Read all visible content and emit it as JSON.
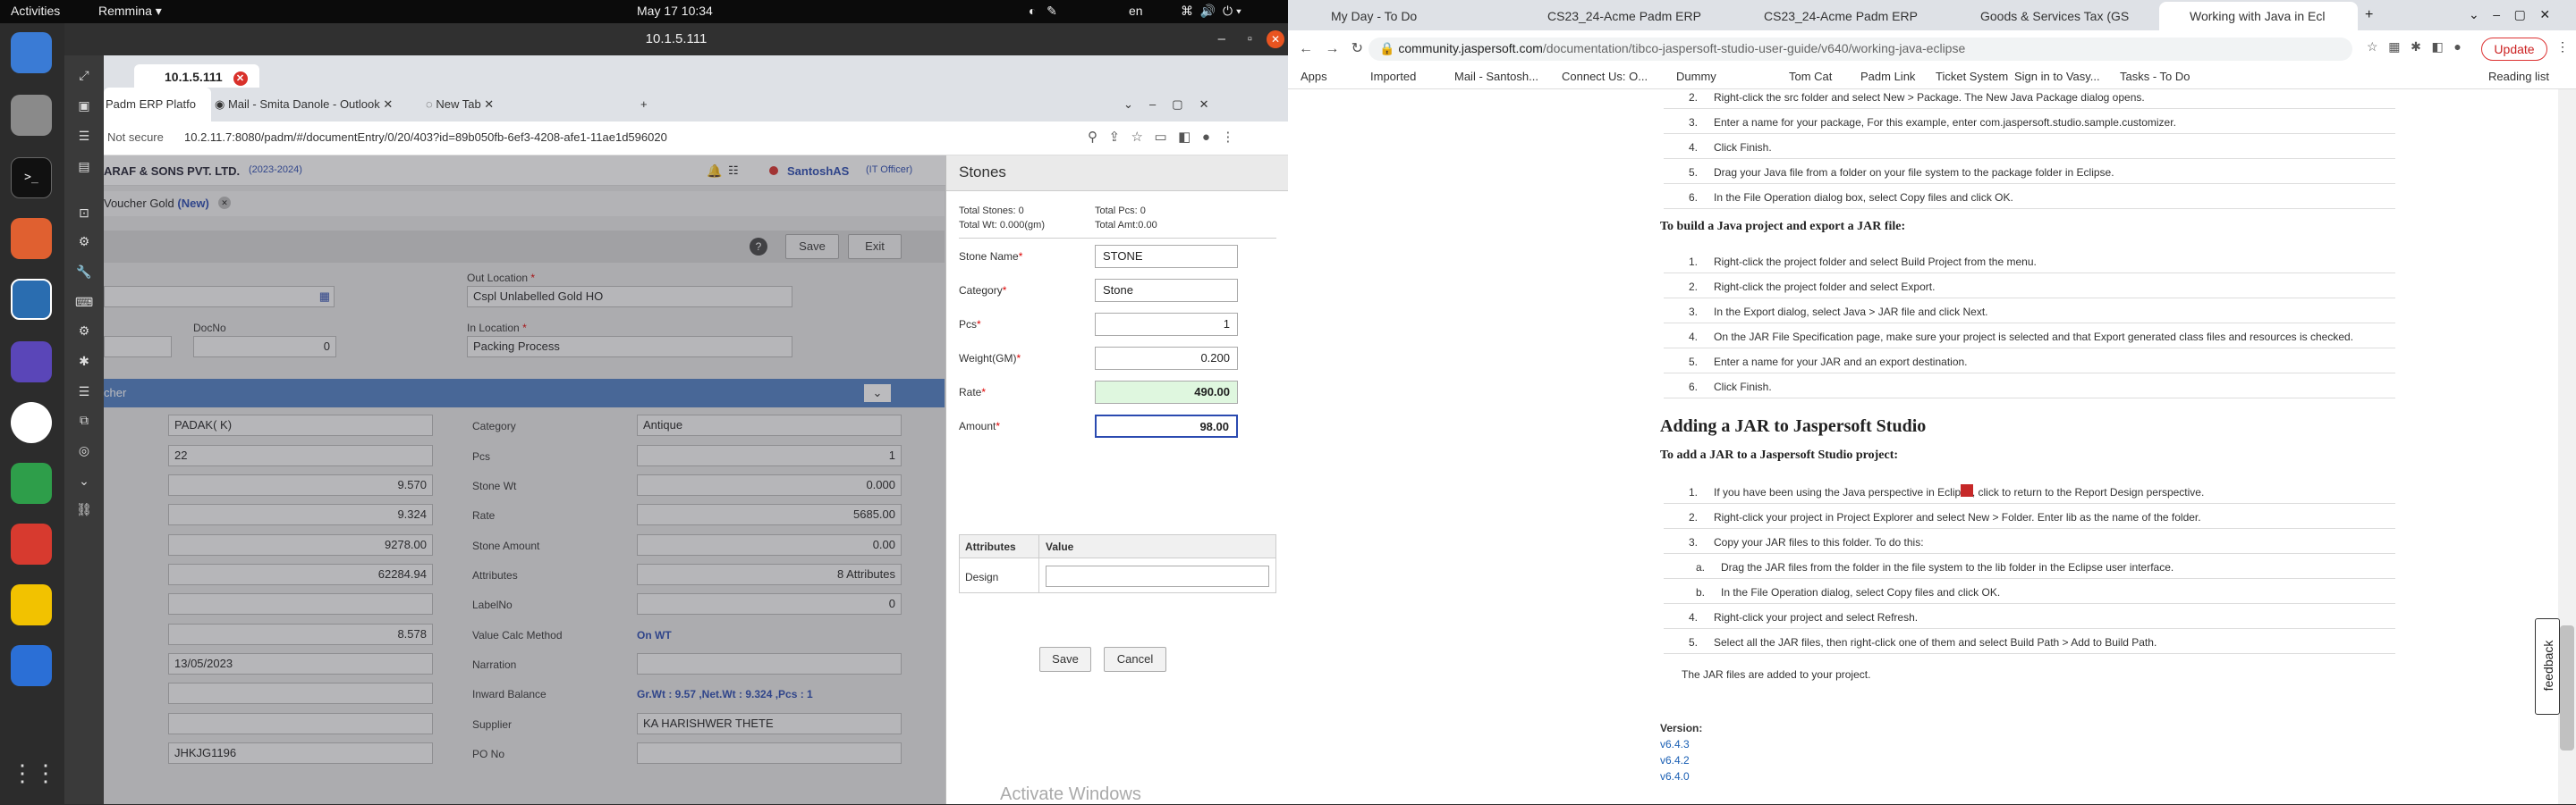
{
  "os": {
    "activities": "Activities",
    "app_menu": "Remmina",
    "clock": "May 17  10:34",
    "lang": "en"
  },
  "remmina": {
    "title": "10.1.5.111",
    "tab_label": "10.1.5.111"
  },
  "chrome": {
    "tabs": [
      "Padm ERP Platfo",
      "Mail - Smita Danole - Outlook",
      "New Tab"
    ],
    "not_secure": "Not secure",
    "url": "10.2.11.7:8080/padm/#/documentEntry/0/20/403?id=89b050fb-6ef3-4208-afe1-11ae1d596020"
  },
  "erp": {
    "company": "ARAF & SONS PVT. LTD.",
    "year": "(2023-2024)",
    "user": "SantoshAS",
    "user_role": "(IT Officer)",
    "voucher_tab": "Voucher Gold",
    "voucher_new": "(New)",
    "save": "Save",
    "exit": "Exit",
    "out_location_label": "Out Location",
    "out_location_value": "Cspl Unlabelled Gold HO",
    "docno_label": "DocNo",
    "docno_value": "0",
    "in_location_label": "In Location",
    "in_location_value": "Packing Process",
    "section": "cher",
    "left_values": [
      "PADAK( K)",
      "22",
      "9.570",
      "9.324",
      "9278.00",
      "62284.94",
      "",
      "8.578",
      "13/05/2023",
      "",
      "",
      "JHKJG1196"
    ],
    "fields": [
      {
        "label": "Category",
        "value": "Antique"
      },
      {
        "label": "Pcs",
        "value": "1"
      },
      {
        "label": "Stone Wt",
        "value": "0.000"
      },
      {
        "label": "Rate",
        "value": "5685.00"
      },
      {
        "label": "Stone Amount",
        "value": "0.00"
      },
      {
        "label": "Attributes",
        "value": "8 Attributes"
      },
      {
        "label": "LabelNo",
        "value": "0"
      },
      {
        "label": "Value Calc Method",
        "value": "On WT"
      },
      {
        "label": "Narration",
        "value": ""
      },
      {
        "label": "Inward Balance",
        "value": "Gr.Wt : 9.57 ,Net.Wt : 9.324 ,Pcs : 1"
      },
      {
        "label": "Supplier",
        "value": "KA HARISHWER THETE"
      },
      {
        "label": "PO No",
        "value": ""
      }
    ]
  },
  "stones": {
    "title": "Stones",
    "total_stones": "Total Stones: 0",
    "total_pcs": "Total Pcs: 0",
    "total_wt": "Total Wt: 0.000(gm)",
    "total_amt": "Total Amt:0.00",
    "rows": [
      {
        "label": "Stone Name",
        "value": "STONE"
      },
      {
        "label": "Category",
        "value": "Stone"
      },
      {
        "label": "Pcs",
        "value": "1"
      },
      {
        "label": "Weight(GM)",
        "value": "0.200"
      },
      {
        "label": "Rate",
        "value": "490.00"
      },
      {
        "label": "Amount",
        "value": "98.00"
      }
    ],
    "attr_header": "Attributes",
    "value_header": "Value",
    "attr_row": "Design",
    "save": "Save",
    "cancel": "Cancel",
    "watermark": "Activate Windows"
  },
  "browser2": {
    "tabs": [
      "My Day - To Do",
      "CS23_24-Acme Padm ERP",
      "CS23_24-Acme Padm ERP",
      "Goods & Services Tax (GS",
      "Working with Java in Ecl"
    ],
    "url_host": "community.jaspersoft.com",
    "url_path": "/documentation/tibco-jaspersoft-studio-user-guide/v640/working-java-eclipse",
    "update": "Update",
    "bookmarks": [
      "Apps",
      "Imported",
      "Mail - Santosh...",
      "Connect Us: O...",
      "Dummy",
      "Tom Cat",
      "Padm Link",
      "Ticket System",
      "Sign in to Vasy...",
      "Tasks - To Do"
    ],
    "reading_list": "Reading list"
  },
  "doc": {
    "list1": [
      {
        "n": "2.",
        "t": "Right-click the src folder and select New > Package. The New Java Package dialog opens."
      },
      {
        "n": "3.",
        "t": "Enter a name for your package, For this example, enter com.jaspersoft.studio.sample.customizer."
      },
      {
        "n": "4.",
        "t": "Click Finish."
      },
      {
        "n": "5.",
        "t": "Drag your Java file from a folder on your file system to the package folder in Eclipse."
      },
      {
        "n": "6.",
        "t": "In the File Operation dialog box, select Copy files and click OK."
      }
    ],
    "heading1": "To build a Java project and export a JAR file:",
    "list2": [
      {
        "n": "1.",
        "t": "Right-click the project folder and select Build Project from the menu."
      },
      {
        "n": "2.",
        "t": "Right-click the project folder and select Export."
      },
      {
        "n": "3.",
        "t": "In the Export dialog, select Java > JAR file and click Next."
      },
      {
        "n": "4.",
        "t": "On the JAR File Specification page, make sure your project is selected and that Export generated class files and resources is checked."
      },
      {
        "n": "5.",
        "t": "Enter a name for your JAR and an export destination."
      },
      {
        "n": "6.",
        "t": "Click Finish."
      }
    ],
    "heading2": "Adding a JAR to Jaspersoft Studio",
    "heading3": "To add a JAR to a Jaspersoft Studio project:",
    "list3": [
      {
        "n": "1.",
        "t": "If you have been using the Java perspective in Eclipse, click       to return to the Report Design perspective."
      },
      {
        "n": "2.",
        "t": "Right-click your project in Project Explorer and select New > Folder. Enter lib as the name of the folder."
      },
      {
        "n": "3.",
        "t": "Copy your JAR files to this folder. To do this:"
      },
      {
        "n": "a.",
        "t": "Drag the JAR files from the folder in the file system to the lib folder in the Eclipse user interface."
      },
      {
        "n": "b.",
        "t": "In the File Operation dialog, select Copy files and click OK."
      },
      {
        "n": "4.",
        "t": "Right-click your project and select Refresh."
      },
      {
        "n": "5.",
        "t": "Select all the JAR files, then right-click one of them and select Build Path > Add to Build Path."
      }
    ],
    "added": "The JAR files are added to your project.",
    "version_label": "Version:",
    "versions": [
      "v6.4.3",
      "v6.4.2",
      "v6.4.0"
    ],
    "feedback": "feedback"
  }
}
